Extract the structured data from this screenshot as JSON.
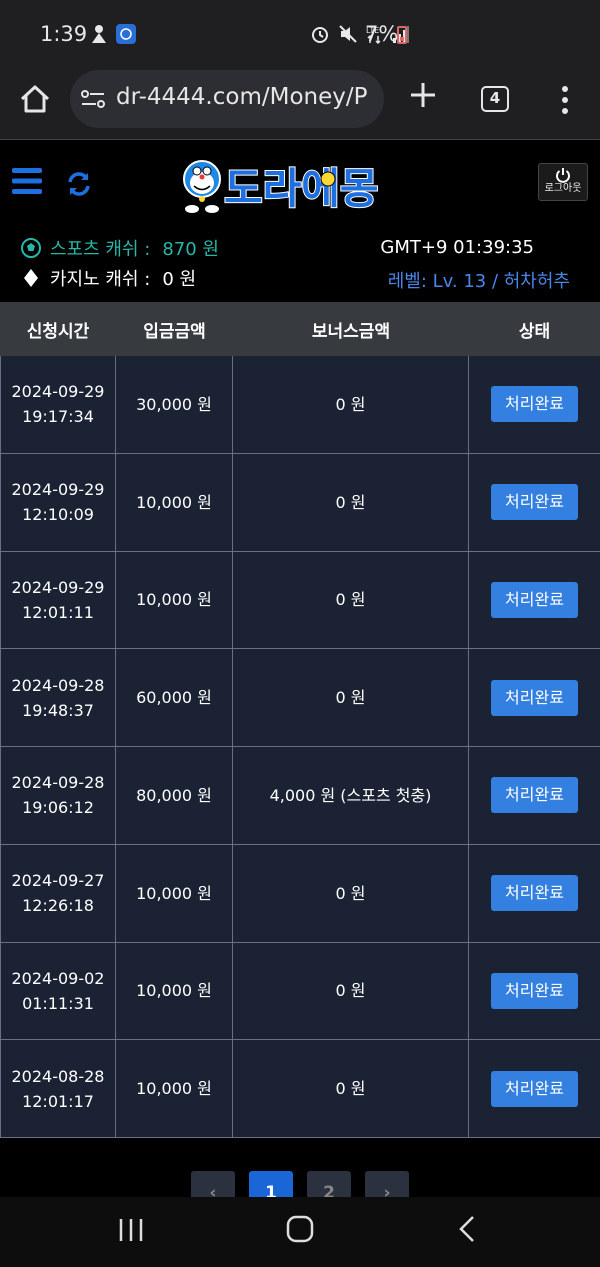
{
  "status_bar": {
    "time": "1:39",
    "battery_text": "7%",
    "icons_left": [
      "person-icon",
      "app-icon"
    ],
    "icons_right": [
      "alarm-icon",
      "mute-icon",
      "lte-icon",
      "signal-icon",
      "battery-icon"
    ]
  },
  "browser": {
    "url": "dr-4444.com/Money/P",
    "tab_count": "4"
  },
  "site": {
    "logo_text": "도라에몽",
    "logout_label": "로그아웃",
    "sports_cash_label": "스포츠 캐쉬 :",
    "sports_cash_value": "870 원",
    "casino_cash_label": "카지노 캐쉬 :",
    "casino_cash_value": "0 원",
    "gmt": "GMT+9 01:39:35",
    "level": "레벨: Lv. 13 / 허차허추"
  },
  "table": {
    "headers": [
      "신청시간",
      "입금금액",
      "보너스금액",
      "상태"
    ],
    "rows": [
      {
        "date": "2024-09-29",
        "time": "19:17:34",
        "amount": "30,000 원",
        "bonus": "0 원",
        "status": "처리완료"
      },
      {
        "date": "2024-09-29",
        "time": "12:10:09",
        "amount": "10,000 원",
        "bonus": "0 원",
        "status": "처리완료"
      },
      {
        "date": "2024-09-29",
        "time": "12:01:11",
        "amount": "10,000 원",
        "bonus": "0 원",
        "status": "처리완료"
      },
      {
        "date": "2024-09-28",
        "time": "19:48:37",
        "amount": "60,000 원",
        "bonus": "0 원",
        "status": "처리완료"
      },
      {
        "date": "2024-09-28",
        "time": "19:06:12",
        "amount": "80,000 원",
        "bonus": "4,000 원 (스포츠 첫충)",
        "status": "처리완료"
      },
      {
        "date": "2024-09-27",
        "time": "12:26:18",
        "amount": "10,000 원",
        "bonus": "0 원",
        "status": "처리완료"
      },
      {
        "date": "2024-09-02",
        "time": "01:11:31",
        "amount": "10,000 원",
        "bonus": "0 원",
        "status": "처리완료"
      },
      {
        "date": "2024-08-28",
        "time": "12:01:17",
        "amount": "10,000 원",
        "bonus": "0 원",
        "status": "처리완료"
      }
    ]
  },
  "pagination": {
    "prev": "‹",
    "pages": [
      "1",
      "2"
    ],
    "active_page": "1",
    "next": "›"
  },
  "colors": {
    "accent": "#3380e0",
    "teal": "#27b6a8",
    "row_bg": "#1a2233",
    "header_bg": "#373b40"
  }
}
